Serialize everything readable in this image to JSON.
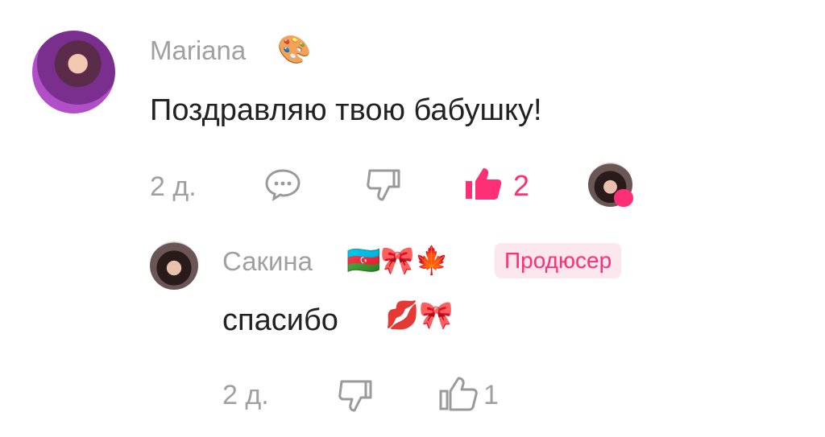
{
  "comment": {
    "author": "Mariana",
    "author_emoji": "🎨",
    "text": "Поздравляю твою бабушку!",
    "time": "2 д.",
    "like_count": "2",
    "icons": {
      "reply": "reply-icon",
      "dislike": "dislike-icon",
      "like": "like-icon"
    },
    "accent_color": "#ff2f75"
  },
  "reply": {
    "author": "Сакина",
    "author_emojis": "🇦🇿🎀🍁",
    "badge": "Продюсер",
    "text": "спасибо",
    "text_emojis": "💋🎀",
    "time": "2 д.",
    "like_count": "1"
  }
}
